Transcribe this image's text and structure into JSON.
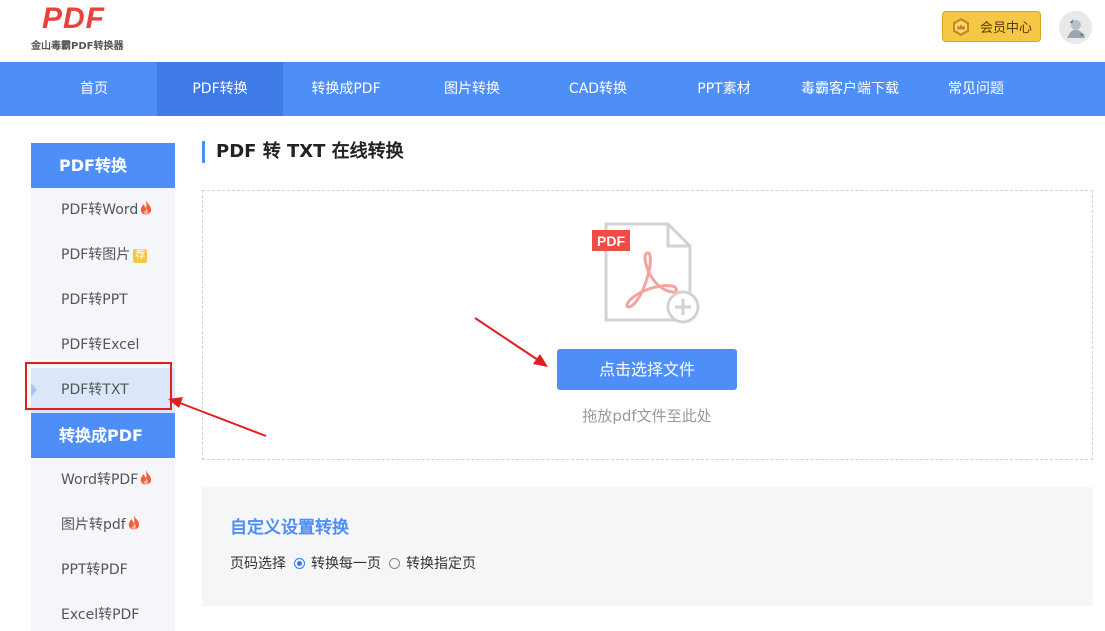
{
  "header": {
    "logo_text": "PDF",
    "logo_subtitle": "金山毒霸PDF转换器",
    "vip_label": "会员中心"
  },
  "nav": {
    "items": [
      {
        "label": "首页"
      },
      {
        "label": "PDF转换"
      },
      {
        "label": "转换成PDF"
      },
      {
        "label": "图片转换"
      },
      {
        "label": "CAD转换"
      },
      {
        "label": "PPT素材"
      },
      {
        "label": "毒霸客户端下载"
      },
      {
        "label": "常见问题"
      }
    ],
    "active_index": 1
  },
  "sidebar": {
    "section1_title": "PDF转换",
    "section1_items": [
      {
        "label": "PDF转Word",
        "badge": "fire"
      },
      {
        "label": "PDF转图片",
        "badge": "荐"
      },
      {
        "label": "PDF转PPT",
        "badge": ""
      },
      {
        "label": "PDF转Excel",
        "badge": ""
      },
      {
        "label": "PDF转TXT",
        "badge": ""
      }
    ],
    "selected": "PDF转TXT",
    "section2_title": "转换成PDF",
    "section2_items": [
      {
        "label": "Word转PDF",
        "badge": "fire"
      },
      {
        "label": "图片转pdf",
        "badge": "fire"
      },
      {
        "label": "PPT转PDF",
        "badge": ""
      },
      {
        "label": "Excel转PDF",
        "badge": ""
      }
    ]
  },
  "main": {
    "title": "PDF 转 TXT 在线转换",
    "file_badge": "PDF",
    "choose_button": "点击选择文件",
    "drop_hint": "拖放pdf文件至此处"
  },
  "settings": {
    "title": "自定义设置转换",
    "page_select_label": "页码选择",
    "options": [
      {
        "label": "转换每一页",
        "checked": true
      },
      {
        "label": "转换指定页",
        "checked": false
      }
    ]
  },
  "colors": {
    "brand_blue": "#4e8ef7",
    "logo_red": "#e8423c",
    "vip_gold": "#f6c744",
    "annotation_red": "#e02020"
  }
}
